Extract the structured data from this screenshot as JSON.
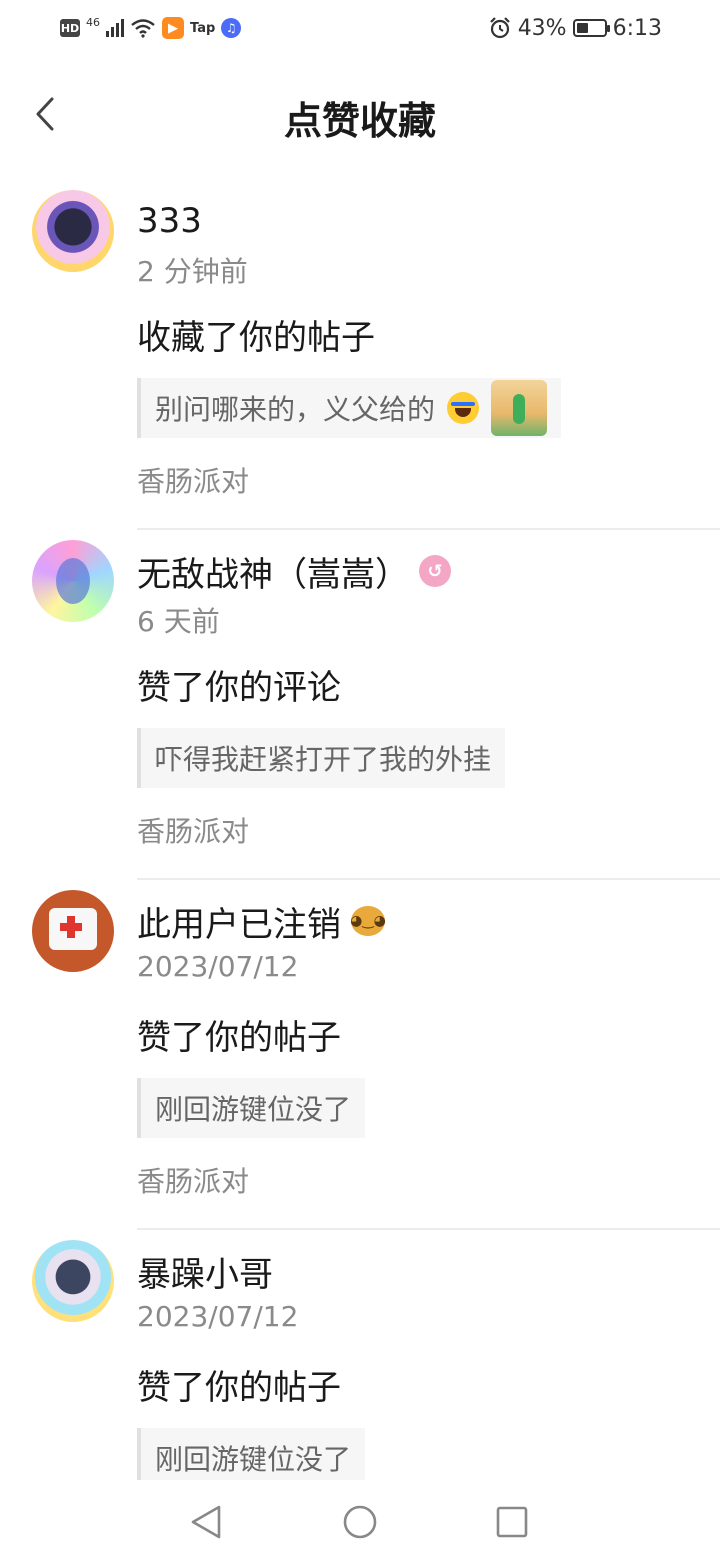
{
  "status_bar": {
    "hd": "HD",
    "network": "46",
    "app_label": "Tap",
    "battery_percent": "43%",
    "battery_level": 0.43,
    "time": "6:13"
  },
  "header": {
    "title": "点赞收藏"
  },
  "notifications": [
    {
      "user": "333",
      "time": "2 分钟前",
      "action": "收藏了你的帖子",
      "quote": "别问哪来的，义父给的",
      "source": "香肠派对"
    },
    {
      "user": "无敌战神（嵩嵩）",
      "time": "6 天前",
      "action": "赞了你的评论",
      "quote": "吓得我赶紧打开了我的外挂",
      "source": "香肠派对"
    },
    {
      "user": "此用户已注销",
      "time": "2023/07/12",
      "action": "赞了你的帖子",
      "quote": "刚回游键位没了",
      "source": "香肠派对"
    },
    {
      "user": "暴躁小哥",
      "time": "2023/07/12",
      "action": "赞了你的帖子",
      "quote": "刚回游键位没了"
    }
  ]
}
